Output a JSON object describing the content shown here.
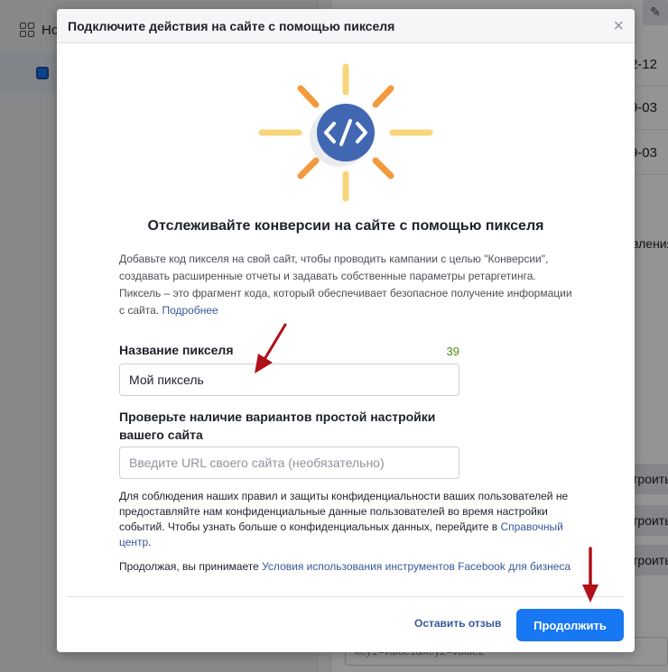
{
  "background": {
    "nav_home_label": "Но",
    "row_dates": [
      "2-12",
      "9-03",
      "9-03"
    ],
    "side_text": "вления",
    "side_buttons": [
      "троить",
      "троить",
      "троить"
    ],
    "bottom_input_placeholder": "key1=value1&key2=value2"
  },
  "modal": {
    "title": "Подключите действия на сайте с помощью пикселя",
    "close_label": "×",
    "hero_icon": "code-brackets-icon",
    "headline": "Отслеживайте конверсии на сайте с помощью пикселя",
    "description": "Добавьте код пикселя на свой сайт, чтобы проводить кампании с целью \"Конверсии\", создавать расширенные отчеты и задавать собственные параметры ретаргетинга. Пиксель – это фрагмент кода, который обеспечивает безопасное получение информации с сайта.",
    "learn_more": "Подробнее",
    "pixel_name_label": "Название пикселя",
    "pixel_name_counter": "39",
    "pixel_name_value": "Мой пиксель",
    "site_check_label": "Проверьте наличие вариантов простой настройки вашего сайта",
    "site_url_placeholder": "Введите URL своего сайта (необязательно)",
    "privacy_notice": "Для соблюдения наших правил и защиты конфиденциальности ваших пользователей не предоставляйте нам конфиденциальные данные пользователей во время настройки событий. Чтобы узнать больше о конфиденциальных данных, перейдите в",
    "help_center_link": "Справочный центр",
    "terms_prefix": "Продолжая, вы принимаете",
    "terms_link": "Условия использования инструментов Facebook для бизнеса",
    "feedback_label": "Оставить отзыв",
    "continue_label": "Продолжить"
  },
  "colors": {
    "accent": "#1877f2",
    "icon_circle": "#4267b2",
    "ray_yellow": "#f7d67a",
    "ray_orange": "#f19a3e",
    "counter_green": "#4d8a13",
    "arrow_red": "#b0101a"
  }
}
